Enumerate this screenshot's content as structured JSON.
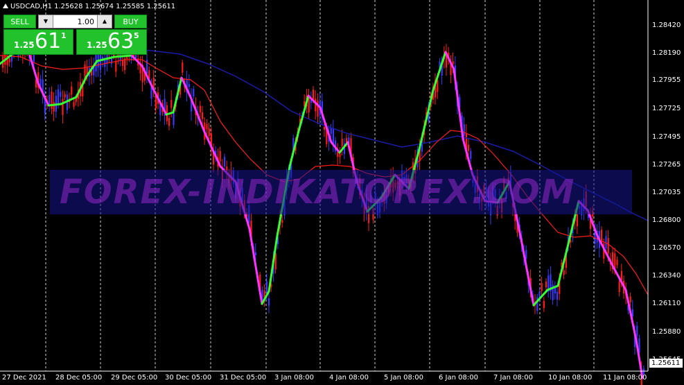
{
  "chart": {
    "symbol_label": "USDCAD,H1  1.25628 1.25674 1.25585 1.25611",
    "watermark": "FOREX-INDIKATOREX.COM",
    "current_price": "1.25611",
    "colors": {
      "background": "#000000",
      "bull_candle": "#3a3aff",
      "bear_candle": "#ff1a1a",
      "ma_red": "#ff1a1a",
      "ma_blue": "#1b1baa",
      "osc_up": "#33ff33",
      "osc_down": "#ff33ff",
      "panel_green": "#22c22c"
    }
  },
  "trade_panel": {
    "sell_label": "SELL",
    "buy_label": "BUY",
    "lot_value": "1.00",
    "lot_down_icon": "triangle-down",
    "lot_up_icon": "triangle-up",
    "sell_price": {
      "prefix": "1.25",
      "big": "61",
      "sup": "1"
    },
    "buy_price": {
      "prefix": "1.25",
      "big": "63",
      "sup": "5"
    }
  },
  "y_axis": {
    "ticks": [
      "1.28420",
      "1.28190",
      "1.27955",
      "1.27725",
      "1.27495",
      "1.27265",
      "1.27035",
      "1.26800",
      "1.26570",
      "1.26340",
      "1.26110",
      "1.25880",
      "1.25645"
    ]
  },
  "x_axis": {
    "ticks": [
      "27 Dec 2021",
      "28 Dec 05:00",
      "29 Dec 05:00",
      "30 Dec 05:00",
      "31 Dec 05:00",
      "3 Jan 08:00",
      "4 Jan 08:00",
      "5 Jan 08:00",
      "6 Jan 08:00",
      "7 Jan 08:00",
      "10 Jan 08:00",
      "11 Jan 08:00"
    ]
  }
}
